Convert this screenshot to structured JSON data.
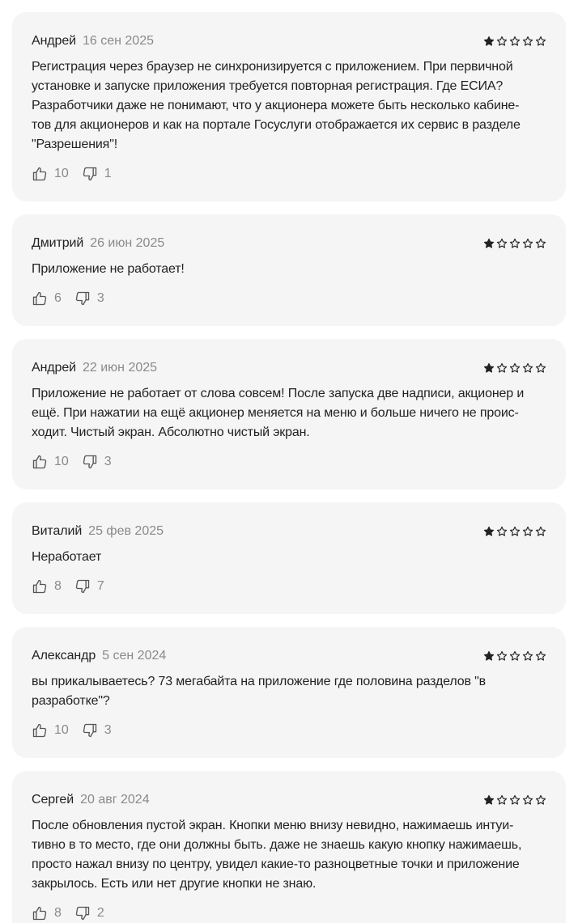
{
  "reviews": [
    {
      "author": "Андрей",
      "date": "16 сен 2025",
      "rating": 1,
      "lines": [
        "Регистрация через браузер не синхронизируется с приложением. При первичной",
        "установке и запуске приложения требуется повторная регистрация. Где ЕСИА?",
        "Разработчики даже не понимают, что у акционера можете быть несколько кабине-",
        "тов для акционеров и как на портале Госуслуги отображается их сервис в разделе",
        "\"Разрешения\"!"
      ],
      "likes": "10",
      "dislikes": "1"
    },
    {
      "author": "Дмитрий",
      "date": "26 июн 2025",
      "rating": 1,
      "lines": [
        "Приложение не работает!"
      ],
      "likes": "6",
      "dislikes": "3"
    },
    {
      "author": "Андрей",
      "date": "22 июн 2025",
      "rating": 1,
      "lines": [
        "Приложение не работает от слова совсем! После запуска две надписи, акционер и",
        "ещё. При нажатии на ещё акционер меняется на меню и больше ничего не проис-",
        "ходит. Чистый экран. Абсолютно чистый экран."
      ],
      "likes": "10",
      "dislikes": "3"
    },
    {
      "author": "Виталий",
      "date": "25 фев 2025",
      "rating": 1,
      "lines": [
        "Неработает"
      ],
      "likes": "8",
      "dislikes": "7"
    },
    {
      "author": "Александр",
      "date": "5 сен 2024",
      "rating": 1,
      "lines": [
        "вы прикалываетесь? 73 мегабайта на приложение где половина разделов \"в",
        "разработке\"?"
      ],
      "likes": "10",
      "dislikes": "3"
    },
    {
      "author": "Сергей",
      "date": "20 авг 2024",
      "rating": 1,
      "lines": [
        "После обновления пустой экран. Кнопки меню внизу невидно, нажимаешь интуи-",
        "тивно в то место, где они должны быть. даже не знаешь какую кнопку нажимаешь,",
        "просто нажал внизу по центру, увидел какие-то разноцветные точки и приложение",
        "закрылось. Есть или нет другие кнопки не знаю."
      ],
      "likes": "8",
      "dislikes": "2"
    }
  ],
  "max_rating": 5,
  "colors": {
    "card_bg": "#f5f5f5",
    "star": "#222222",
    "muted": "#8a8a8a"
  },
  "icons": {
    "star_filled": "star-filled-icon",
    "star_empty": "star-outline-icon",
    "like": "thumbs-up-icon",
    "dislike": "thumbs-down-icon"
  }
}
